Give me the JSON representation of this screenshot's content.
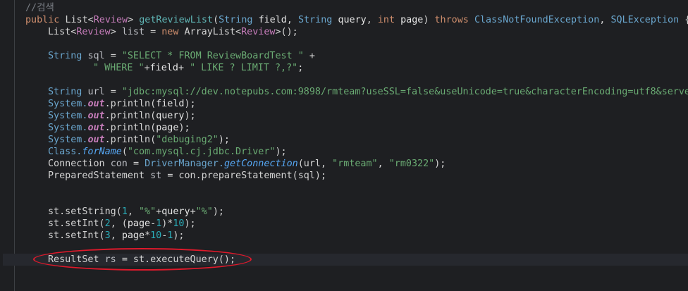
{
  "lines": [
    {
      "top": "3",
      "indent": "0",
      "tokens": [
        [
          "c-comment",
          "//검색"
        ]
      ]
    },
    {
      "top": "20",
      "indent": "0",
      "tokens": [
        [
          "c-kw",
          "public "
        ],
        [
          "c-plain",
          "List<"
        ],
        [
          "c-gen",
          "Review"
        ],
        [
          "c-plain",
          "> "
        ],
        [
          "c-method",
          "getReviewList"
        ],
        [
          "c-plain",
          "("
        ],
        [
          "c-type",
          "String "
        ],
        [
          "c-param",
          "field"
        ],
        [
          "c-plain",
          ", "
        ],
        [
          "c-type",
          "String "
        ],
        [
          "c-param",
          "query"
        ],
        [
          "c-plain",
          ", "
        ],
        [
          "c-kw",
          "int "
        ],
        [
          "c-param",
          "page"
        ],
        [
          "c-plain",
          ") "
        ],
        [
          "c-kw",
          "throws "
        ],
        [
          "c-type",
          "ClassNotFoundException"
        ],
        [
          "c-plain",
          ", "
        ],
        [
          "c-type",
          "SQLException "
        ],
        [
          "c-plain",
          "{"
        ]
      ]
    },
    {
      "top": "37",
      "indent": "1",
      "tokens": [
        [
          "c-plain",
          "List<"
        ],
        [
          "c-gen",
          "Review"
        ],
        [
          "c-plain",
          "> "
        ],
        [
          "c-var",
          "list "
        ],
        [
          "c-plain",
          "= "
        ],
        [
          "c-kw",
          "new "
        ],
        [
          "c-plain",
          "ArrayList<"
        ],
        [
          "c-gen",
          "Review"
        ],
        [
          "c-plain",
          ">();"
        ]
      ]
    },
    {
      "top": "71",
      "indent": "1",
      "tokens": [
        [
          "c-type",
          "String "
        ],
        [
          "c-var",
          "sql "
        ],
        [
          "c-plain",
          "= "
        ],
        [
          "c-str",
          "\"SELECT * FROM ReviewBoardTest \" "
        ],
        [
          "c-plain",
          "+"
        ]
      ]
    },
    {
      "top": "88",
      "indent": "2",
      "tokens": [
        [
          "c-str",
          "\" WHERE \""
        ],
        [
          "c-plain",
          "+"
        ],
        [
          "c-param",
          "field"
        ],
        [
          "c-plain",
          "+ "
        ],
        [
          "c-str",
          "\" LIKE ? LIMIT ?,?\""
        ],
        [
          "c-plain",
          ";"
        ]
      ]
    },
    {
      "top": "122",
      "indent": "1",
      "tokens": [
        [
          "c-type",
          "String "
        ],
        [
          "c-var",
          "url "
        ],
        [
          "c-plain",
          "= "
        ],
        [
          "c-str",
          "\"jdbc:mysql://dev.notepubs.com:9898/rmteam?useSSL=false&useUnicode=true&characterEncoding=utf8&server"
        ]
      ]
    },
    {
      "top": "139",
      "indent": "1",
      "tokens": [
        [
          "c-type",
          "System."
        ],
        [
          "c-field",
          "out"
        ],
        [
          "c-plain",
          ".println("
        ],
        [
          "c-param",
          "field"
        ],
        [
          "c-plain",
          ");"
        ]
      ]
    },
    {
      "top": "156",
      "indent": "1",
      "tokens": [
        [
          "c-type",
          "System."
        ],
        [
          "c-field",
          "out"
        ],
        [
          "c-plain",
          ".println("
        ],
        [
          "c-param",
          "query"
        ],
        [
          "c-plain",
          ");"
        ]
      ]
    },
    {
      "top": "173",
      "indent": "1",
      "tokens": [
        [
          "c-type",
          "System."
        ],
        [
          "c-field",
          "out"
        ],
        [
          "c-plain",
          ".println("
        ],
        [
          "c-param",
          "page"
        ],
        [
          "c-plain",
          ");"
        ]
      ]
    },
    {
      "top": "190",
      "indent": "1",
      "tokens": [
        [
          "c-type",
          "System."
        ],
        [
          "c-field",
          "out"
        ],
        [
          "c-plain",
          ".println("
        ],
        [
          "c-str",
          "\"debuging2\""
        ],
        [
          "c-plain",
          ");"
        ]
      ]
    },
    {
      "top": "207",
      "indent": "1",
      "tokens": [
        [
          "c-type",
          "Class."
        ],
        [
          "c-static",
          "forName"
        ],
        [
          "c-plain",
          "("
        ],
        [
          "c-str",
          "\"com.mysql.cj.jdbc.Driver\""
        ],
        [
          "c-plain",
          ");"
        ]
      ]
    },
    {
      "top": "224",
      "indent": "1",
      "tokens": [
        [
          "c-plain",
          "Connection "
        ],
        [
          "c-var",
          "con "
        ],
        [
          "c-plain",
          "= "
        ],
        [
          "c-type",
          "DriverManager."
        ],
        [
          "c-static",
          "getConnection"
        ],
        [
          "c-plain",
          "(url, "
        ],
        [
          "c-str",
          "\"rmteam\""
        ],
        [
          "c-plain",
          ", "
        ],
        [
          "c-str",
          "\"rm0322\""
        ],
        [
          "c-plain",
          ");"
        ]
      ]
    },
    {
      "top": "241",
      "indent": "1",
      "tokens": [
        [
          "c-plain",
          "PreparedStatement "
        ],
        [
          "c-var",
          "st "
        ],
        [
          "c-plain",
          "= con.prepareStatement(sql);"
        ]
      ]
    },
    {
      "top": "292",
      "indent": "1",
      "tokens": [
        [
          "c-plain",
          "st.setString("
        ],
        [
          "c-num",
          "1"
        ],
        [
          "c-plain",
          ", "
        ],
        [
          "c-str",
          "\"%\""
        ],
        [
          "c-plain",
          "+"
        ],
        [
          "c-param",
          "query"
        ],
        [
          "c-plain",
          "+"
        ],
        [
          "c-str",
          "\"%\""
        ],
        [
          "c-plain",
          ");"
        ]
      ]
    },
    {
      "top": "309",
      "indent": "1",
      "tokens": [
        [
          "c-plain",
          "st.setInt("
        ],
        [
          "c-num",
          "2"
        ],
        [
          "c-plain",
          ", ("
        ],
        [
          "c-param",
          "page"
        ],
        [
          "c-plain",
          "-"
        ],
        [
          "c-num",
          "1"
        ],
        [
          "c-plain",
          ")*"
        ],
        [
          "c-num",
          "10"
        ],
        [
          "c-plain",
          ");"
        ]
      ]
    },
    {
      "top": "326",
      "indent": "1",
      "tokens": [
        [
          "c-plain",
          "st.setInt("
        ],
        [
          "c-num",
          "3"
        ],
        [
          "c-plain",
          ", "
        ],
        [
          "c-param",
          "page"
        ],
        [
          "c-plain",
          "*"
        ],
        [
          "c-num",
          "10"
        ],
        [
          "c-plain",
          "-"
        ],
        [
          "c-num",
          "1"
        ],
        [
          "c-plain",
          ");"
        ]
      ]
    },
    {
      "top": "360",
      "indent": "1",
      "tokens": [
        [
          "c-plain",
          "ResultSet "
        ],
        [
          "c-var",
          "rs "
        ],
        [
          "c-plain",
          "= st.executeQuery();"
        ]
      ]
    }
  ]
}
